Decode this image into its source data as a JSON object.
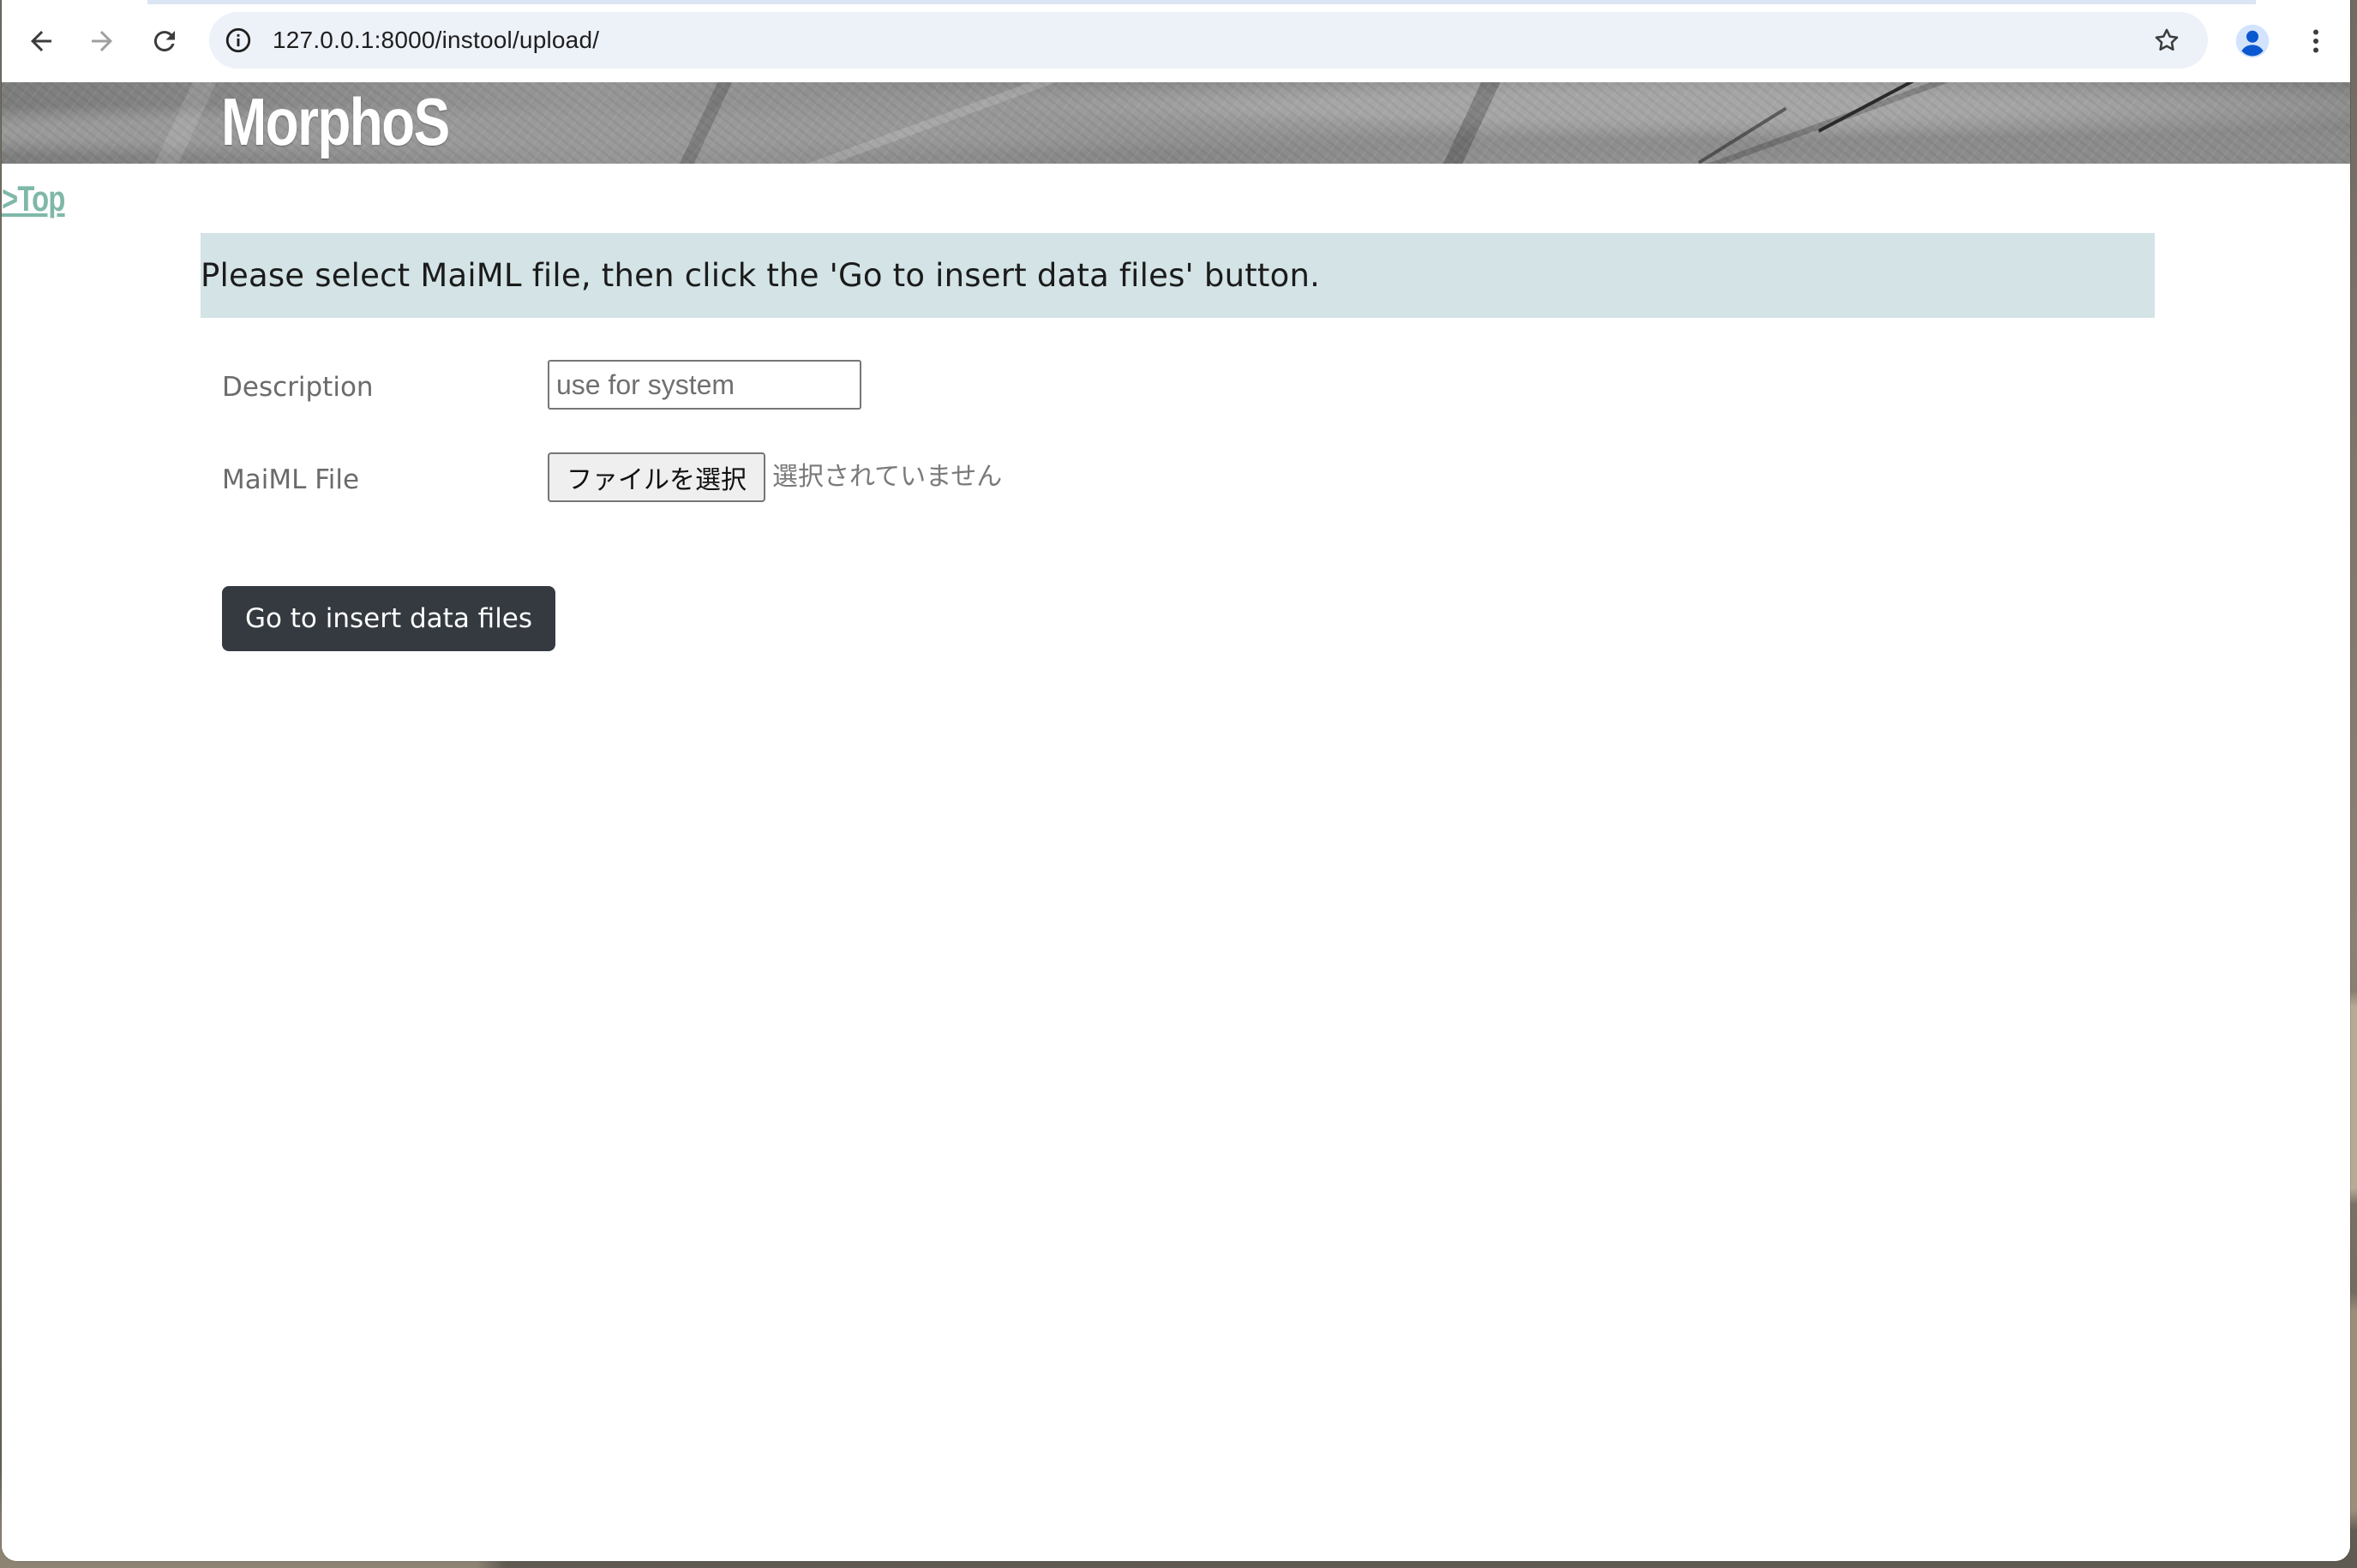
{
  "browser": {
    "url": "127.0.0.1:8000/instool/upload/",
    "icons": {
      "back": "back-arrow-icon",
      "forward": "forward-arrow-icon",
      "reload": "reload-icon",
      "site_info": "info-icon",
      "bookmark": "star-icon",
      "profile": "profile-icon",
      "menu": "kebab-menu-icon"
    }
  },
  "header": {
    "logo": "MorphoS"
  },
  "nav": {
    "top_link": ">Top"
  },
  "notice": {
    "text": "Please select MaiML file, then click the 'Go to insert data files' button."
  },
  "form": {
    "description_label": "Description",
    "description_value": "",
    "description_placeholder": "use for system",
    "file_label": "MaiML File",
    "file_button_label": "ファイルを選択",
    "file_status": "選択されていません"
  },
  "actions": {
    "submit_label": "Go to insert data files"
  },
  "colors": {
    "notice_bg": "#d3e3e6",
    "button_bg": "#343a40",
    "link": "#7fb8a8"
  }
}
